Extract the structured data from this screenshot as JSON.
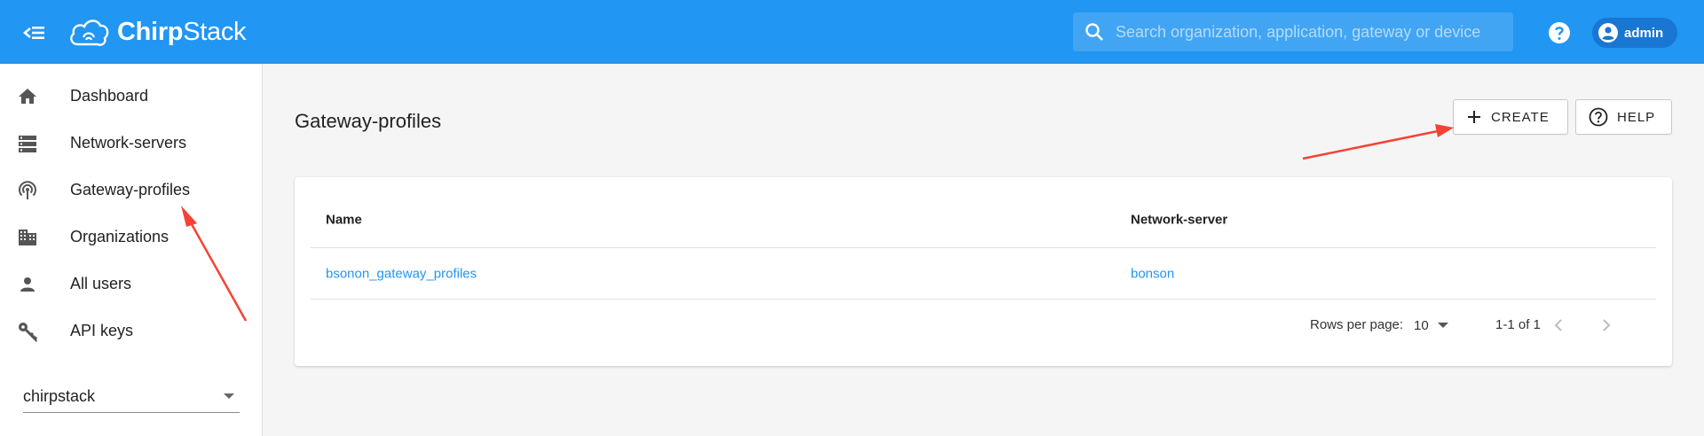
{
  "header": {
    "logo_text_bold": "Chirp",
    "logo_text_light": "Stack",
    "search_placeholder": "Search organization, application, gateway or device",
    "user_name": "admin"
  },
  "sidebar": {
    "items": [
      {
        "label": "Dashboard",
        "icon": "home-icon"
      },
      {
        "label": "Network-servers",
        "icon": "server-icon"
      },
      {
        "label": "Gateway-profiles",
        "icon": "gateway-icon"
      },
      {
        "label": "Organizations",
        "icon": "building-icon"
      },
      {
        "label": "All users",
        "icon": "person-icon"
      },
      {
        "label": "API keys",
        "icon": "key-icon"
      }
    ],
    "organization_select": "chirpstack"
  },
  "main": {
    "title": "Gateway-profiles",
    "create_label": "CREATE",
    "help_label": "HELP",
    "table": {
      "columns": [
        "Name",
        "Network-server"
      ],
      "rows": [
        {
          "name": "bsonon_gateway_profiles",
          "network_server": "bonson"
        }
      ]
    },
    "pagination": {
      "rows_per_page_label": "Rows per page:",
      "rows_per_page_value": "10",
      "range": "1-1 of 1"
    }
  },
  "colors": {
    "app_bar": "#2196f3",
    "link": "#2196f3",
    "annotation_arrow": "#f44336"
  }
}
